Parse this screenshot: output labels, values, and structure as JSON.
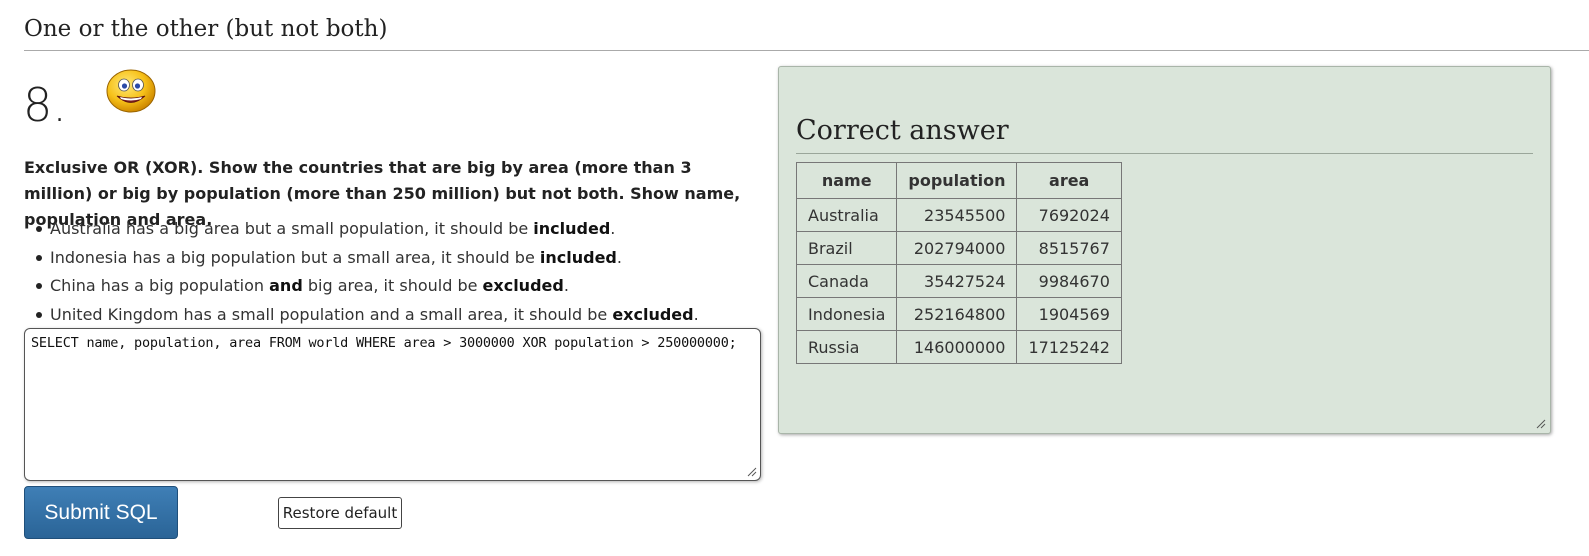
{
  "section": {
    "title": "One or the other (but not both)"
  },
  "question": {
    "number": "8.",
    "text": "Exclusive OR (XOR). Show the countries that are big by area (more than 3 million) or big by population (more than 250 million) but not both. Show name, population and area.",
    "bullets": [
      {
        "pre": "Australia has a big area but a small population, it should be ",
        "b1": "included",
        "mid": "",
        "b2": "",
        "post": "."
      },
      {
        "pre": "Indonesia has a big population but a small area, it should be ",
        "b1": "included",
        "mid": "",
        "b2": "",
        "post": "."
      },
      {
        "pre": "China has a big population ",
        "b1": "and",
        "mid": " big area, it should be ",
        "b2": "excluded",
        "post": "."
      },
      {
        "pre": "United Kingdom has a small population and a small area, it should be ",
        "b1": "excluded",
        "mid": "",
        "b2": "",
        "post": "."
      }
    ]
  },
  "editor": {
    "value": "SELECT name, population, area FROM world WHERE area > 3000000 XOR population > 250000000;"
  },
  "buttons": {
    "submit": "Submit SQL",
    "restore": "Restore default"
  },
  "answer": {
    "title": "Correct answer",
    "columns": [
      "name",
      "population",
      "area"
    ],
    "rows": [
      [
        "Australia",
        "23545500",
        "7692024"
      ],
      [
        "Brazil",
        "202794000",
        "8515767"
      ],
      [
        "Canada",
        "35427524",
        "9984670"
      ],
      [
        "Indonesia",
        "252164800",
        "1904569"
      ],
      [
        "Russia",
        "146000000",
        "17125242"
      ]
    ]
  },
  "icons": {
    "mascot": "smiley-face-icon"
  },
  "colors": {
    "panel_bg": "#dae5da",
    "submit_bg": "#2a6497"
  }
}
